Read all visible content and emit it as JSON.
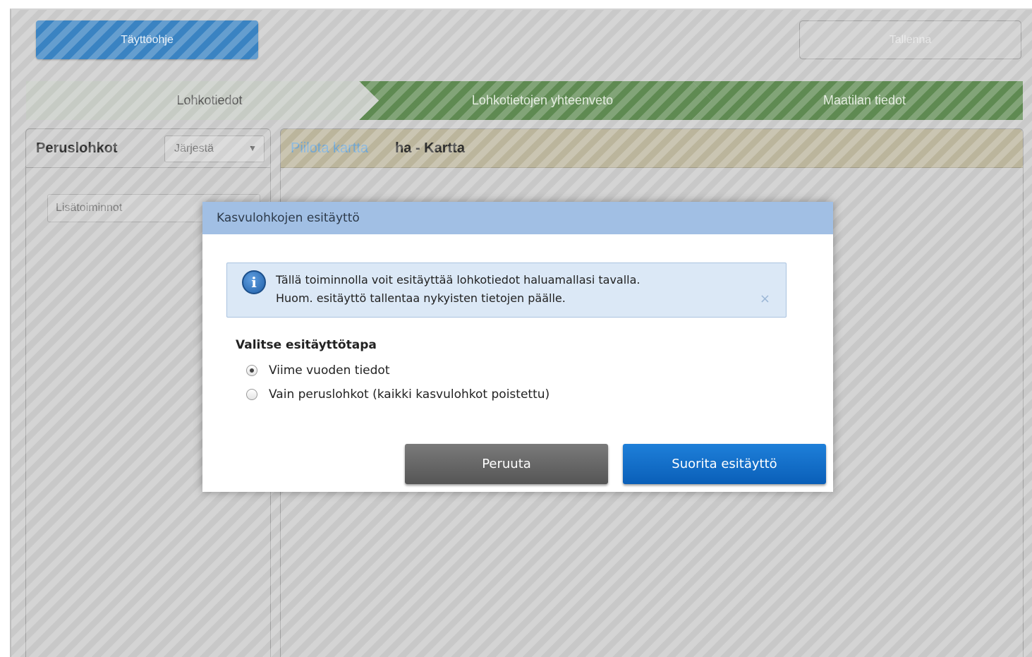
{
  "toolbar": {
    "guide_label": "Täyttöohje",
    "save_label": "Tallenna"
  },
  "steps": [
    {
      "label": "Lohkotiedot"
    },
    {
      "label": "Lohkotietojen yhteenveto"
    },
    {
      "label": "Maatilan tiedot"
    }
  ],
  "left_panel": {
    "title": "Peruslohkot",
    "sort_label": "Järjestä",
    "more_actions_label": "Lisätoiminnot"
  },
  "map_panel": {
    "hide_map_link": "Piilota kartta",
    "title": "ha - Kartta"
  },
  "dialog": {
    "title": "Kasvulohkojen esitäyttö",
    "info_line1": "Tällä toiminnolla voit esitäyttää lohkotiedot haluamallasi tavalla.",
    "info_line2": "Huom. esitäyttö tallentaa nykyisten tietojen päälle.",
    "info_close": "×",
    "method_title": "Valitse esitäyttötapa",
    "options": [
      {
        "label": "Viime vuoden tiedot",
        "selected": true
      },
      {
        "label": "Vain peruslohkot (kaikki kasvulohkot poistettu)",
        "selected": false
      }
    ],
    "cancel_label": "Peruuta",
    "confirm_label": "Suorita esitäyttö"
  },
  "colors": {
    "dialog_header": "#a1bfe4",
    "primary_button": "#0a6ecb",
    "step_active": "#c6cbc4",
    "step_inactive": "#5f8a52",
    "map_header": "#bbb59c"
  }
}
